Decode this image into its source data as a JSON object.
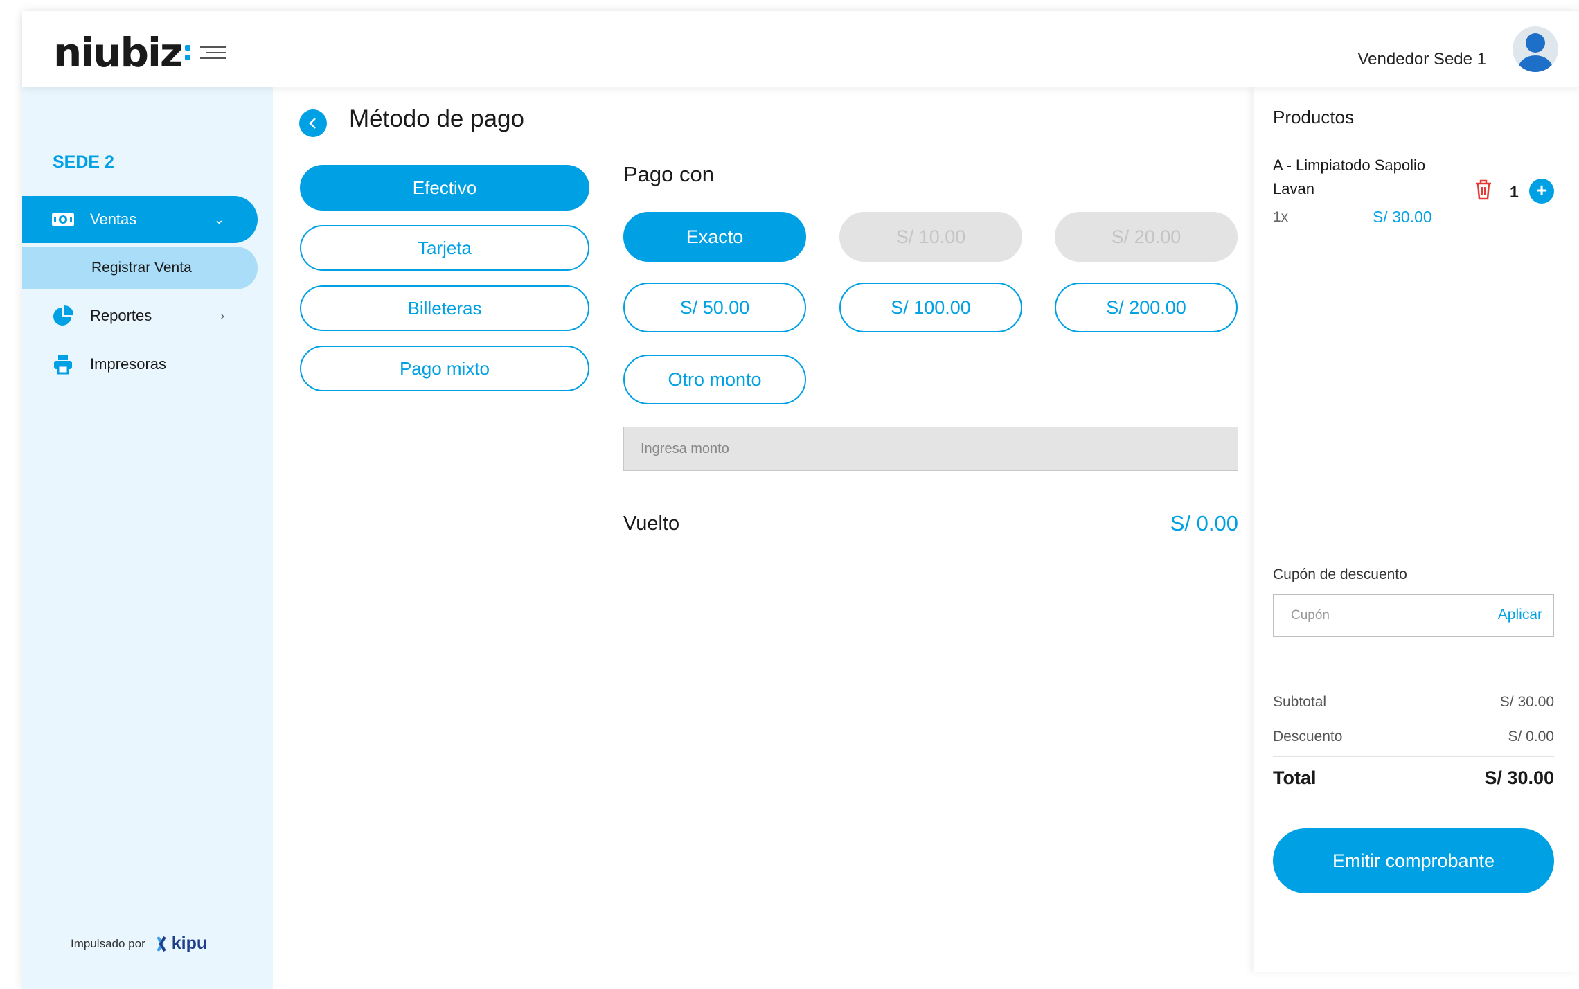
{
  "header": {
    "logo_text": "niubiz",
    "user_name": "Vendedor Sede 1"
  },
  "sidebar": {
    "sede": "SEDE 2",
    "items": [
      {
        "label": "Ventas",
        "icon": "cash-icon",
        "arrow": "⌄"
      },
      {
        "label": "Registrar Venta"
      },
      {
        "label": "Reportes",
        "icon": "pie-chart-icon",
        "arrow": "›"
      },
      {
        "label": "Impresoras",
        "icon": "printer-icon"
      }
    ],
    "powered_by": "Impulsado por",
    "powered_brand": "kipu"
  },
  "main": {
    "title": "Método de pago",
    "methods": [
      "Efectivo",
      "Tarjeta",
      "Billeteras",
      "Pago mixto"
    ],
    "active_method": "Efectivo",
    "pago_con_label": "Pago con",
    "amounts": [
      "Exacto",
      "S/ 10.00",
      "S/ 20.00",
      "S/ 50.00",
      "S/ 100.00",
      "S/ 200.00",
      "Otro monto"
    ],
    "active_amount": "Exacto",
    "disabled_amounts": [
      "S/ 10.00",
      "S/ 20.00"
    ],
    "amount_placeholder": "Ingresa monto",
    "vuelto_label": "Vuelto",
    "vuelto_value": "S/ 0.00"
  },
  "cart": {
    "title": "Productos",
    "product": {
      "name": "A - Limpiatodo Sapolio Lavan",
      "qty": "1",
      "multiplier": "1x",
      "price": "S/ 30.00"
    },
    "coupon_label": "Cupón de descuento",
    "coupon_placeholder": "Cupón",
    "coupon_apply": "Aplicar",
    "subtotal_label": "Subtotal",
    "subtotal_value": "S/ 30.00",
    "discount_label": "Descuento",
    "discount_value": "S/ 0.00",
    "total_label": "Total",
    "total_value": "S/ 30.00",
    "emit_label": "Emitir comprobante"
  },
  "colors": {
    "accent": "#00a1e4",
    "sidebar_bg": "#eaf6fd",
    "sidebar_sub_bg": "#a9ddf8",
    "danger": "#e53935"
  }
}
